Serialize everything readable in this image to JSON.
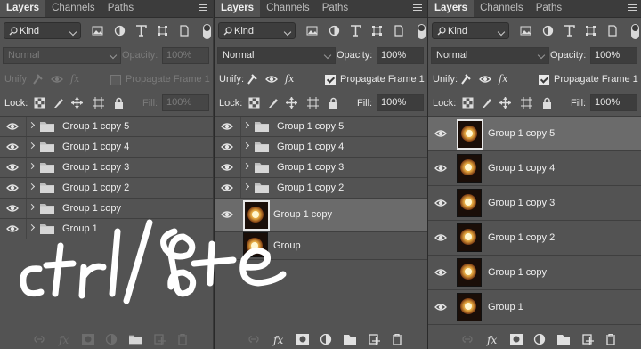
{
  "panels": [
    {
      "tabs": [
        "Layers",
        "Channels",
        "Paths"
      ],
      "filter": {
        "kind": "Kind"
      },
      "blend_mode": "Normal",
      "opacity_label": "Opacity:",
      "opacity_value": "100%",
      "unify_label": "Unify:",
      "propagate_label": "Propagate Frame 1",
      "lock_label": "Lock:",
      "fill_label": "Fill:",
      "fill_value": "100%",
      "layers": [
        "Group 1 copy 5",
        "Group 1 copy 4",
        "Group 1 copy 3",
        "Group 1 copy 2",
        "Group 1 copy",
        "Group 1"
      ]
    },
    {
      "tabs": [
        "Layers",
        "Channels",
        "Paths"
      ],
      "filter": {
        "kind": "Kind"
      },
      "blend_mode": "Normal",
      "opacity_label": "Opacity:",
      "opacity_value": "100%",
      "unify_label": "Unify:",
      "propagate_label": "Propagate Frame 1",
      "lock_label": "Lock:",
      "fill_label": "Fill:",
      "fill_value": "100%",
      "layers": [
        "Group 1 copy 5",
        "Group 1 copy 4",
        "Group 1 copy 3",
        "Group 1 copy 2"
      ],
      "selected_layer": "Group 1 copy",
      "partial_layer": "Group"
    },
    {
      "tabs": [
        "Layers",
        "Channels",
        "Paths"
      ],
      "filter": {
        "kind": "Kind"
      },
      "blend_mode": "Normal",
      "opacity_label": "Opacity:",
      "opacity_value": "100%",
      "unify_label": "Unify:",
      "propagate_label": "Propagate Frame 1",
      "lock_label": "Lock:",
      "fill_label": "Fill:",
      "fill_value": "100%",
      "layers": [
        "Group 1 copy 5",
        "Group 1 copy 4",
        "Group 1 copy 3",
        "Group 1 copy 2",
        "Group 1 copy",
        "Group 1"
      ]
    }
  ],
  "annotation": {
    "text": "ctrl/⌘+e",
    "color": "#ffffff"
  },
  "colors": {
    "panel_bg": "#535353",
    "selected_row": "#6b6b6b"
  }
}
